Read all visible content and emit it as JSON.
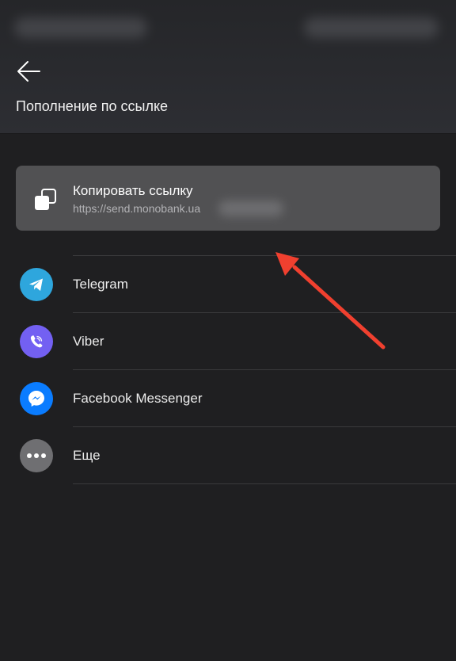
{
  "header": {
    "title": "Пополнение по ссылке",
    "back_icon": "arrow-left-icon"
  },
  "copy_link": {
    "label": "Копировать ссылку",
    "url": "https://send.monobank.ua",
    "icon": "copy-icon"
  },
  "share_options": [
    {
      "label": "Telegram",
      "icon": "telegram-icon",
      "color": "#2ea6dd"
    },
    {
      "label": "Viber",
      "icon": "viber-icon",
      "color": "#7360f2"
    },
    {
      "label": "Facebook Messenger",
      "icon": "messenger-icon",
      "color": "#0a7cff"
    },
    {
      "label": "Еще",
      "icon": "more-icon",
      "color": "#6f6f72"
    }
  ],
  "colors": {
    "background": "#1f1f21",
    "header": "#2a2b2f",
    "card": "#515153",
    "annotation_arrow": "#f0402f"
  }
}
